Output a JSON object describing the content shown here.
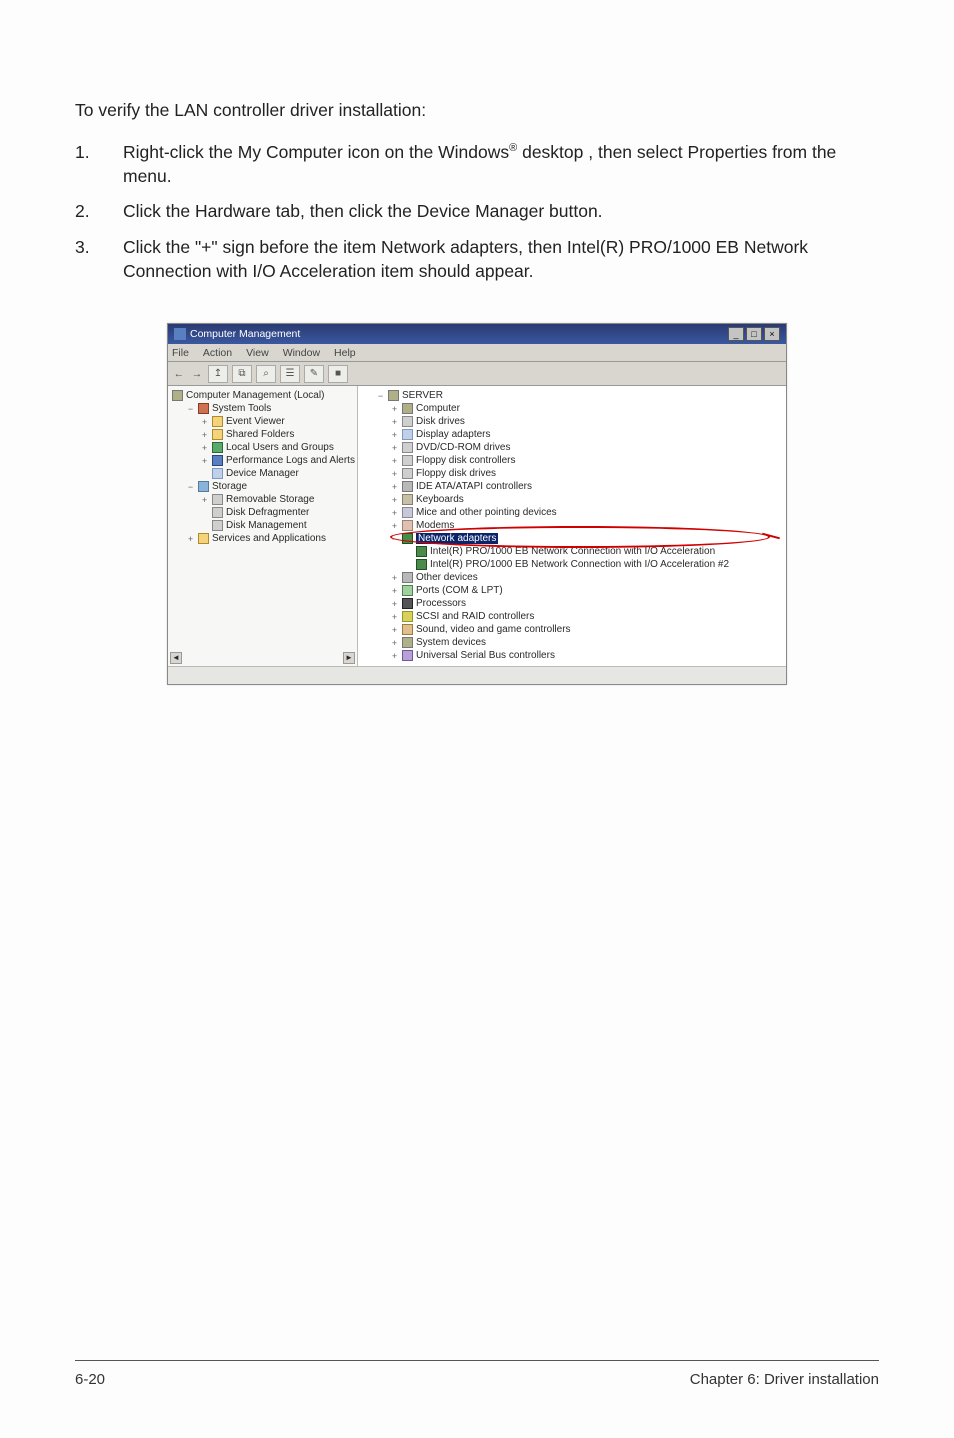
{
  "instructions": {
    "intro": "To verify the LAN controller driver installation:",
    "steps": [
      {
        "num": "1.",
        "text_a": "Right-click the My Computer icon on the Windows",
        "sup": "®",
        "text_b": " desktop , then select Properties from the menu."
      },
      {
        "num": "2.",
        "text_a": "Click the Hardware tab, then click the Device Manager button.",
        "sup": "",
        "text_b": ""
      },
      {
        "num": "3.",
        "text_a": "Click the \"+\" sign before the item Network adapters, then Intel(R) PRO/1000 EB Network Connection with I/O Acceleration item should appear.",
        "sup": "",
        "text_b": ""
      }
    ]
  },
  "window": {
    "title": "Computer Management",
    "win_buttons": {
      "min": "_",
      "max": "□",
      "close": "×"
    },
    "menu": [
      "File",
      "Action",
      "View",
      "Window",
      "Help"
    ],
    "toolbar_arrows": [
      "←",
      "→"
    ],
    "toolbar_icons": [
      "↥",
      "⧉",
      "⌕",
      "☰",
      "✎",
      "■"
    ]
  },
  "left_tree": {
    "root": "Computer Management (Local)",
    "items": [
      {
        "tw": "−",
        "icon": "ic-tool",
        "label": "System Tools",
        "indent": "indent1"
      },
      {
        "tw": "+",
        "icon": "ic-folder",
        "label": "Event Viewer",
        "indent": "indent2"
      },
      {
        "tw": "+",
        "icon": "ic-folder",
        "label": "Shared Folders",
        "indent": "indent2"
      },
      {
        "tw": "+",
        "icon": "ic-green",
        "label": "Local Users and Groups",
        "indent": "indent2"
      },
      {
        "tw": "+",
        "icon": "ic-blue",
        "label": "Performance Logs and Alerts",
        "indent": "indent2"
      },
      {
        "tw": "",
        "icon": "ic-device",
        "label": "Device Manager",
        "indent": "indent2"
      },
      {
        "tw": "−",
        "icon": "ic-storage",
        "label": "Storage",
        "indent": "indent1"
      },
      {
        "tw": "+",
        "icon": "ic-disk",
        "label": "Removable Storage",
        "indent": "indent2"
      },
      {
        "tw": "",
        "icon": "ic-disk",
        "label": "Disk Defragmenter",
        "indent": "indent2"
      },
      {
        "tw": "",
        "icon": "ic-disk",
        "label": "Disk Management",
        "indent": "indent2"
      },
      {
        "tw": "+",
        "icon": "ic-folder",
        "label": "Services and Applications",
        "indent": "indent1"
      }
    ]
  },
  "right_tree": {
    "root": "SERVER",
    "items": [
      {
        "tw": "+",
        "icon": "ic-computer",
        "label": "Computer",
        "indent": "indent2"
      },
      {
        "tw": "+",
        "icon": "ic-disk",
        "label": "Disk drives",
        "indent": "indent2"
      },
      {
        "tw": "+",
        "icon": "ic-device",
        "label": "Display adapters",
        "indent": "indent2"
      },
      {
        "tw": "+",
        "icon": "ic-disk",
        "label": "DVD/CD-ROM drives",
        "indent": "indent2"
      },
      {
        "tw": "+",
        "icon": "ic-disk",
        "label": "Floppy disk controllers",
        "indent": "indent2"
      },
      {
        "tw": "+",
        "icon": "ic-disk",
        "label": "Floppy disk drives",
        "indent": "indent2"
      },
      {
        "tw": "+",
        "icon": "ic-gray",
        "label": "IDE ATA/ATAPI controllers",
        "indent": "indent2"
      },
      {
        "tw": "+",
        "icon": "ic-keyb",
        "label": "Keyboards",
        "indent": "indent2"
      },
      {
        "tw": "+",
        "icon": "ic-mouse",
        "label": "Mice and other pointing devices",
        "indent": "indent2"
      },
      {
        "tw": "+",
        "icon": "ic-modem",
        "label": "Modems",
        "indent": "indent2"
      },
      {
        "tw": "−",
        "icon": "ic-net",
        "label": "Network adapters",
        "indent": "indent2",
        "selected": true
      },
      {
        "tw": "",
        "icon": "ic-net",
        "label": "Intel(R) PRO/1000 EB Network Connection with I/O Acceleration",
        "indent": "indent3"
      },
      {
        "tw": "",
        "icon": "ic-net",
        "label": "Intel(R) PRO/1000 EB Network Connection with I/O Acceleration #2",
        "indent": "indent3"
      },
      {
        "tw": "+",
        "icon": "ic-gray",
        "label": "Other devices",
        "indent": "indent2"
      },
      {
        "tw": "+",
        "icon": "ic-port",
        "label": "Ports (COM & LPT)",
        "indent": "indent2"
      },
      {
        "tw": "+",
        "icon": "ic-proc",
        "label": "Processors",
        "indent": "indent2"
      },
      {
        "tw": "+",
        "icon": "ic-scsi",
        "label": "SCSI and RAID controllers",
        "indent": "indent2"
      },
      {
        "tw": "+",
        "icon": "ic-sound",
        "label": "Sound, video and game controllers",
        "indent": "indent2"
      },
      {
        "tw": "+",
        "icon": "ic-computer",
        "label": "System devices",
        "indent": "indent2"
      },
      {
        "tw": "+",
        "icon": "ic-usb",
        "label": "Universal Serial Bus controllers",
        "indent": "indent2"
      }
    ]
  },
  "footer": {
    "left": "6-20",
    "right": "Chapter 6: Driver installation"
  }
}
